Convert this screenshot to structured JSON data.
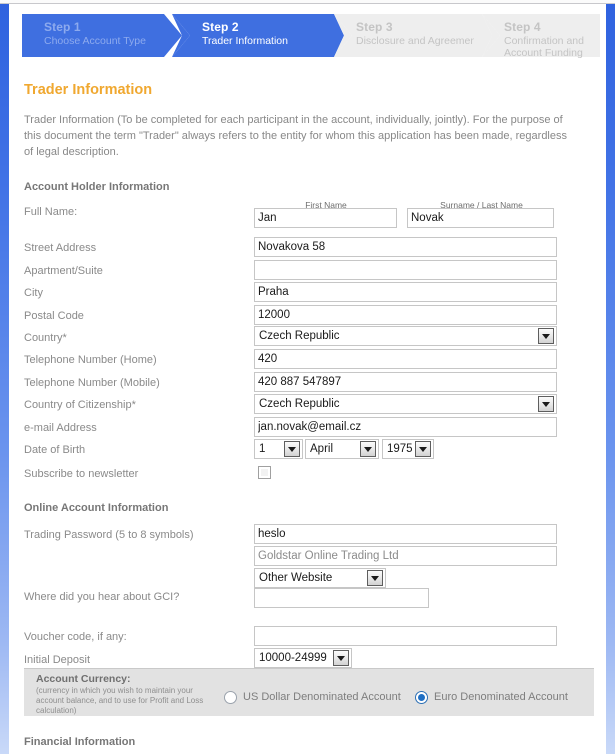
{
  "steps": [
    {
      "number": "Step 1",
      "label": "Choose Account Type",
      "state": "done"
    },
    {
      "number": "Step 2",
      "label": "Trader Information",
      "state": "active"
    },
    {
      "number": "Step 3",
      "label": "Disclosure and Agreements",
      "state": "pending"
    },
    {
      "number": "Step 4",
      "label": "Confirmation and Account Funding",
      "state": "pending"
    }
  ],
  "page": {
    "title": "Trader Information",
    "intro": "Trader Information (To be completed for each participant in the account, individually, jointly). For the purpose of this document the term \"Trader\" always refers to the entity for whom this application has been made, regardless of legal description."
  },
  "sections": {
    "holder": "Account Holder Information",
    "online": "Online Account Information",
    "financial": "Financial Information"
  },
  "holder": {
    "full_name_label": "Full Name:",
    "first_name_mini": "First Name",
    "surname_mini": "Surname / Last Name",
    "first_name_value": "Jan",
    "surname_value": "Novak",
    "street_label": "Street Address",
    "street_value": "Novakova 58",
    "apartment_label": "Apartment/Suite",
    "apartment_value": "",
    "city_label": "City",
    "city_value": "Praha",
    "postal_label": "Postal Code",
    "postal_value": "12000",
    "country_label": "Country*",
    "country_value": "Czech Republic",
    "phone_home_label": "Telephone Number (Home)",
    "phone_home_value": "420",
    "phone_mobile_label": "Telephone Number (Mobile)",
    "phone_mobile_value": "420 887 547897",
    "citizenship_label": "Country of Citizenship*",
    "citizenship_value": "Czech Republic",
    "email_label": "e-mail Address",
    "email_value": "jan.novak@email.cz",
    "dob_label": "Date of Birth",
    "dob_day": "1",
    "dob_month": "April",
    "dob_year": "1975",
    "newsletter_label": "Subscribe to newsletter",
    "newsletter_checked": false
  },
  "online": {
    "password_label": "Trading Password (5 to 8 symbols)",
    "password_value": "heslo",
    "broker_value": "Goldstar Online Trading Ltd",
    "hear_about_select_value": "Other Website",
    "hear_about_label": "Where did you hear about GCI?",
    "hear_about_value": "",
    "voucher_label": "Voucher code, if any:",
    "voucher_value": "",
    "deposit_label": "Initial Deposit",
    "deposit_value": "10000-24999"
  },
  "currency": {
    "title": "Account Currency:",
    "note": "(currency in which you wish to maintain your account balance, and to use for Profit and Loss calculation)",
    "options": [
      {
        "label": "US Dollar Denominated Account",
        "selected": false
      },
      {
        "label": "Euro Denominated Account",
        "selected": true
      }
    ]
  },
  "colors": {
    "accent_blue": "#3f6fe0",
    "title_orange": "#f0a830",
    "band_grey": "#e2e2e2",
    "radio_blue": "#1f6fc4"
  }
}
